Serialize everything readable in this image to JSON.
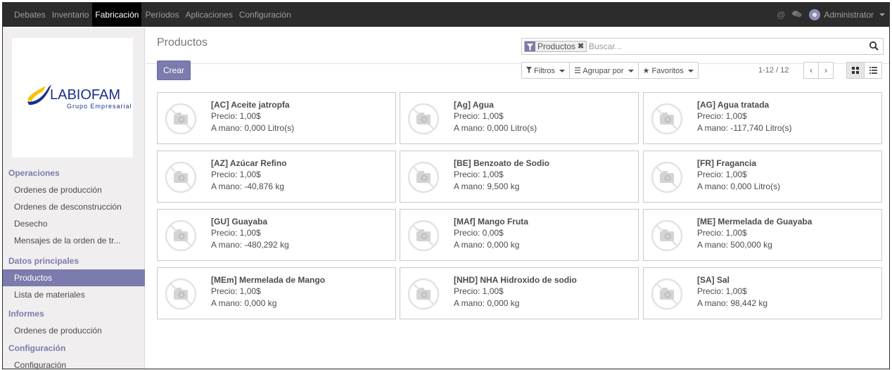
{
  "topbar": {
    "menu": [
      "Debates",
      "Inventario",
      "Fabricación",
      "Períodos",
      "Aplicaciones",
      "Configuración"
    ],
    "active": "Fabricación",
    "user": "Administrator"
  },
  "sidebar": {
    "logo_text": "LABIOFAM",
    "logo_sub": "Grupo Empresarial",
    "sections": [
      {
        "title": "Operaciones",
        "items": [
          "Ordenes de producción",
          "Ordenes de desconstrucción",
          "Desecho",
          "Mensajes de la orden de tr..."
        ]
      },
      {
        "title": "Datos principales",
        "items": [
          "Productos",
          "Lista de materiales"
        ]
      },
      {
        "title": "Informes",
        "items": [
          "Ordenes de producción"
        ]
      },
      {
        "title": "Configuración",
        "items": [
          "Configuración"
        ]
      }
    ],
    "active_item": "Productos"
  },
  "control": {
    "title": "Productos",
    "create_label": "Crear",
    "facet_label": "Productos",
    "search_placeholder": "Buscar...",
    "filters_label": "Filtros",
    "groupby_label": "Agrupar por",
    "favorites_label": "Favoritos",
    "pager": "1-12 / 12"
  },
  "products": [
    {
      "name": "[AC] Aceite jatropfa",
      "price": "Precio: 1,00$",
      "onhand": "A mano: 0,000 Litro(s)"
    },
    {
      "name": "[Ag] Agua",
      "price": "Precio: 1,00$",
      "onhand": "A mano: 0,000 Litro(s)"
    },
    {
      "name": "[AG] Agua tratada",
      "price": "Precio: 1,00$",
      "onhand": "A mano: -117,740 Litro(s)"
    },
    {
      "name": "[AZ] Azúcar Refino",
      "price": "Precio: 1,00$",
      "onhand": "A mano: -40,876 kg"
    },
    {
      "name": "[BE] Benzoato de Sodio",
      "price": "Precio: 1,00$",
      "onhand": "A mano: 9,500 kg"
    },
    {
      "name": "[FR] Fragancia",
      "price": "Precio: 1,00$",
      "onhand": "A mano: 0,000 Litro(s)"
    },
    {
      "name": "[GU] Guayaba",
      "price": "Precio: 1,00$",
      "onhand": "A mano: -480,292 kg"
    },
    {
      "name": "[MAf] Mango Fruta",
      "price": "Precio: 0,00$",
      "onhand": "A mano: 0,000 kg"
    },
    {
      "name": "[ME] Mermelada de Guayaba",
      "price": "Precio: 1,00$",
      "onhand": "A mano: 500,000 kg"
    },
    {
      "name": "[MEm] Mermelada de Mango",
      "price": "Precio: 1,00$",
      "onhand": "A mano: 0,000 kg"
    },
    {
      "name": "[NHD] NHA Hidroxido de sodio",
      "price": "Precio: 1,00$",
      "onhand": "A mano: 0,000 kg"
    },
    {
      "name": "[SA] Sal",
      "price": "Precio: 1,00$",
      "onhand": "A mano: 98,442 kg"
    }
  ],
  "colors": {
    "accent": "#7c7bad",
    "topbar": "#2c2c2c",
    "sidebar": "#f0eeee",
    "logo_blue": "#1d2e8c",
    "logo_yellow": "#f6c400"
  },
  "icons": [
    "at-icon",
    "chat-icon",
    "avatar-icon",
    "filter-icon",
    "close-icon",
    "search-icon",
    "caret-down-icon",
    "list-icon",
    "star-icon",
    "chevron-left-icon",
    "chevron-right-icon",
    "kanban-view-icon",
    "list-view-icon",
    "no-image-icon"
  ]
}
